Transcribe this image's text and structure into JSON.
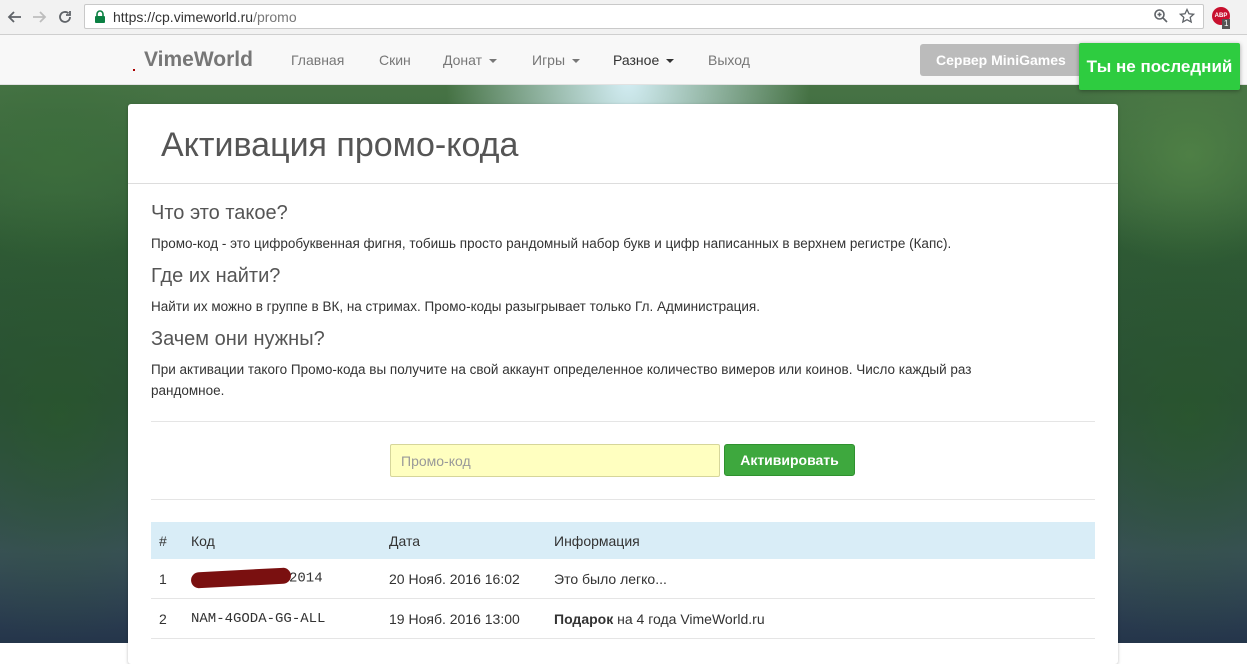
{
  "browser": {
    "url_host": "https://cp.vimeworld.ru",
    "url_path": "/promo",
    "extension_badge": "1",
    "extension_label": "ABP"
  },
  "navbar": {
    "brand": "VimeWorld",
    "items": [
      {
        "label": "Главная"
      },
      {
        "label": "Скин"
      },
      {
        "label": "Донат"
      },
      {
        "label": "Игры"
      },
      {
        "label": "Разное"
      },
      {
        "label": "Выход"
      }
    ],
    "server_button": "Сервер MiniGames"
  },
  "toast": "Ты не последний",
  "page": {
    "title": "Активация промо-кода",
    "sections": [
      {
        "heading": "Что это такое?",
        "text": "Промо-код - это цифробуквенная фигня, тобишь просто рандомный набор букв и цифр написанных в верхнем регистре (Капс)."
      },
      {
        "heading": "Где их найти?",
        "text": "Найти их можно в группе в ВК, на стримах. Промо-коды разыгрывает только Гл. Администрация."
      },
      {
        "heading": "Зачем они нужны?",
        "text": "При активации такого Промо-кода вы получите на свой аккаунт определенное количество вимеров или коинов. Число каждый раз рандомное."
      }
    ],
    "promo_placeholder": "Промо-код",
    "activate_button": "Активировать"
  },
  "table": {
    "headers": [
      "#",
      "Код",
      "Дата",
      "Информация"
    ],
    "rows": [
      {
        "num": "1",
        "code": "2014",
        "date": "20 Нояб. 2016 16:02",
        "info": "Это было легко..."
      },
      {
        "num": "2",
        "code": "NAM-4GODA-GG-ALL",
        "date": "19 Нояб. 2016 13:00",
        "info_bold": "Подарок",
        "info": " на 4 года VimeWorld.ru"
      }
    ]
  },
  "colors": {
    "toast": "#2ecc40",
    "activate": "#3ea83e",
    "input_bg": "#ffffc0",
    "table_header": "#d9edf7"
  }
}
